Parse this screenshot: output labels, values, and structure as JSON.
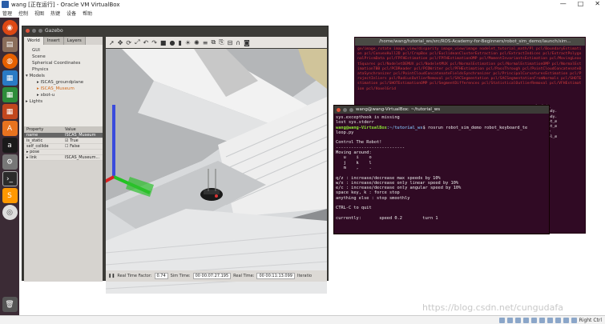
{
  "host": {
    "window_title": "wang [正在运行] - Oracle VM VirtualBox",
    "menu": [
      "管理",
      "控制",
      "视图",
      "热键",
      "设备",
      "帮助"
    ],
    "window_buttons": [
      "—",
      "□",
      "✕"
    ],
    "hotkey": "Right Ctrl"
  },
  "launcher": {
    "items": [
      "ubuntu",
      "files",
      "firefox",
      "writer",
      "calc",
      "impress",
      "software-center",
      "amazon",
      "settings",
      "terminal",
      "sublime",
      "dvd"
    ],
    "trash": "trash"
  },
  "gazebo": {
    "title": "Gazebo",
    "tabs": [
      "World",
      "Insert",
      "Layers"
    ],
    "tree": [
      {
        "label": "GUI",
        "level": 1
      },
      {
        "label": "Scene",
        "level": 1
      },
      {
        "label": "Spherical Coordinates",
        "level": 1
      },
      {
        "label": "Physics",
        "level": 1
      },
      {
        "label": "Models",
        "level": 1
      },
      {
        "label": "ISCAS_groundplane",
        "level": 2
      },
      {
        "label": "ISCAS_Museum",
        "level": 2,
        "selected": true
      },
      {
        "label": "xbot-u",
        "level": 2
      },
      {
        "label": "Lights",
        "level": 1
      }
    ],
    "props_header": [
      "Property",
      "Value"
    ],
    "props": [
      {
        "name": "name",
        "value": "ISCAS_Museum",
        "selected": true
      },
      {
        "name": "is_static",
        "value": "True"
      },
      {
        "name": "self_collide",
        "value": "False"
      },
      {
        "name": "pose",
        "value": ""
      },
      {
        "name": "link",
        "value": "ISCAS_Museum..."
      }
    ],
    "bottom": {
      "rtf_label": "Real Time Factor:",
      "rtf_value": "0.74",
      "sim_label": "Sim Time:",
      "sim_value": "00 00:07:27.195",
      "real_label": "Real Time:",
      "real_value": "00 00:11:13.099",
      "iter_label": "Iteratio"
    }
  },
  "terminal_bg": {
    "title": "/home/wang/tutorial_ws/src/ROS-Academy-for-Beginners/robot_sim_demo/launch/sim...",
    "body": "ge/image_rotate image_view/disparity image_view/image nodelet_tutorial_math/Pl pcl/BoundaryEstimation pcl/ConvexHull2D pcl/CropBox pcl/EuclideanClusterExtraction pcl/ExtractIndices pcl/ExtractPolygonalPrismData pcl/FPFHEstimation pcl/FPFHEstimationOMP pcl/MomentInvariantsEstimation pcl/MovingLeastSquares pcl/NodeletDEMUX pcl/NodeletMUX pcl/NormalEstimation pcl/NormalEstimationOMP pcl/NormalEstimationTBB pcl/PCDReader pcl/PCDWriter pcl/PFHEstimation pcl/PassThrough pcl/PointCloudConcatenateDataSynchronizer pcl/PointCloudConcatenateFieldsSynchronizer pcl/PrincipalCurvaturesEstimation pcl/ProjectInliers pcl/RadiusOutlierRemoval pcl/SACSegmentation pcl/SACSegmentationFromNormals pcl/SHOTEstimation pcl/SHOTEstimationOMP pcl/SegmentDifferences pcl/StatisticalOutlierRemoval pcl/VFHEstimation pcl/VoxelGrid",
    "right_lines": [
      "/point_",
      "",
      "",
      "",
      "ure ready.",
      "ure ready.",
      "",
      "",
      "",
      "_nodelet_m",
      "_nodelet_m",
      "/manage",
      "",
      "",
      "_cel_sel_m"
    ]
  },
  "terminal": {
    "title": "wang@wang-VirtualBox: ~/tutorial_ws",
    "line1": "sys.excepthook is missing",
    "line2": "lost sys.stderr",
    "prompt_user": "wang@wang-VirtualBox",
    "prompt_path": ":~/tutorial_ws",
    "command": "$ rosrun robot_sim_demo robot_keyboard_te",
    "command_wrap": "leop.py",
    "body": "\nControl The Robot!\n---------------------------\nMoving around:\n   u    i    o\n   j    k    l\n   m    ,    .\n\nq/z : increase/decrease max speeds by 10%\nw/x : increase/decrease only linear speed by 10%\ne/c : increase/decrease only angular speed by 10%\nspace key, k : force stop\nanything else : stop smoothly\n\nCTRL-C to quit\n\ncurrently:       speed 0.2        turn 1"
  },
  "watermark": "https://blog.csdn.net/cungudafa"
}
